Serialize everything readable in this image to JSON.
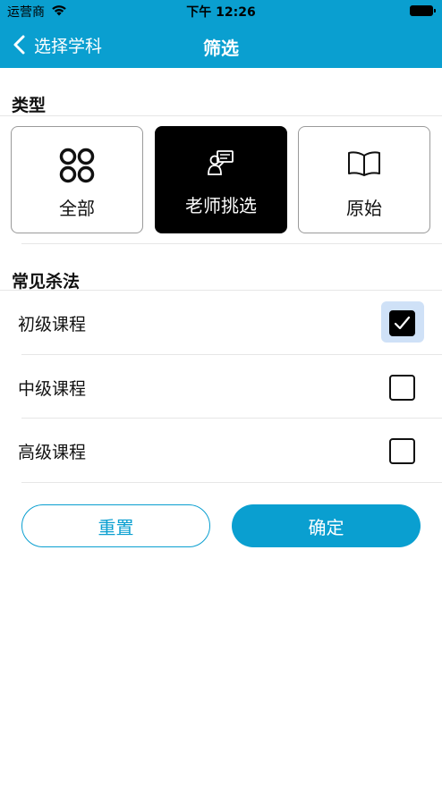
{
  "status_bar": {
    "carrier": "运营商",
    "time": "下午 12:26"
  },
  "nav": {
    "back_label": "选择学科",
    "title": "筛选"
  },
  "type_section": {
    "title": "类型",
    "cards": [
      {
        "label": "全部",
        "icon": "grid-circles-icon",
        "selected": false
      },
      {
        "label": "老师挑选",
        "icon": "teacher-board-icon",
        "selected": true
      },
      {
        "label": "原始",
        "icon": "open-book-icon",
        "selected": false
      }
    ]
  },
  "common_section": {
    "title": "常见杀法",
    "options": [
      {
        "label": "初级课程",
        "checked": true
      },
      {
        "label": "中级课程",
        "checked": false
      },
      {
        "label": "高级课程",
        "checked": false
      }
    ]
  },
  "actions": {
    "reset_label": "重置",
    "confirm_label": "确定"
  },
  "colors": {
    "accent": "#0a9fd0",
    "selected_card": "#000000",
    "checkbox_highlight": "#cfe1f7"
  }
}
